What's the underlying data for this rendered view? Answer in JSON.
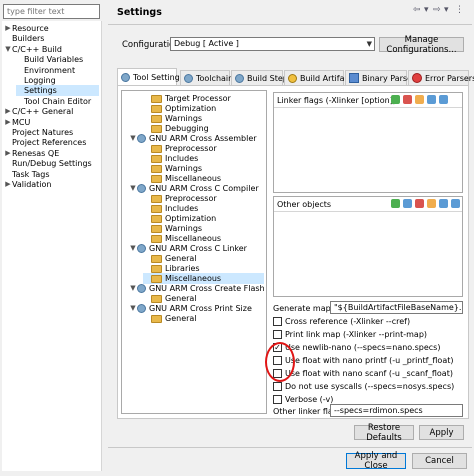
{
  "sidebar": {
    "filter_placeholder": "type filter text",
    "items": [
      {
        "label": "Resource",
        "twisty": "▶",
        "indent": 0
      },
      {
        "label": "Builders",
        "twisty": "",
        "indent": 0
      },
      {
        "label": "C/C++ Build",
        "twisty": "▼",
        "indent": 0
      },
      {
        "label": "Build Variables",
        "twisty": "",
        "indent": 1
      },
      {
        "label": "Environment",
        "twisty": "",
        "indent": 1
      },
      {
        "label": "Logging",
        "twisty": "",
        "indent": 1
      },
      {
        "label": "Settings",
        "twisty": "",
        "indent": 1,
        "selected": true
      },
      {
        "label": "Tool Chain Editor",
        "twisty": "",
        "indent": 1
      },
      {
        "label": "C/C++ General",
        "twisty": "▶",
        "indent": 0
      },
      {
        "label": "MCU",
        "twisty": "▶",
        "indent": 0
      },
      {
        "label": "Project Natures",
        "twisty": "",
        "indent": 0
      },
      {
        "label": "Project References",
        "twisty": "",
        "indent": 0
      },
      {
        "label": "Renesas QE",
        "twisty": "▶",
        "indent": 0
      },
      {
        "label": "Run/Debug Settings",
        "twisty": "",
        "indent": 0
      },
      {
        "label": "Task Tags",
        "twisty": "",
        "indent": 0
      },
      {
        "label": "Validation",
        "twisty": "▶",
        "indent": 0
      }
    ]
  },
  "header": {
    "title": "Settings"
  },
  "config": {
    "label": "Configuration:",
    "value": "Debug  [ Active ]",
    "manage_button": "Manage Configurations..."
  },
  "tabs": [
    {
      "label": "Tool Settings",
      "active": true
    },
    {
      "label": "Toolchain",
      "active": false
    },
    {
      "label": "Build Steps",
      "active": false
    },
    {
      "label": "Build Artifact",
      "active": false
    },
    {
      "label": "Binary Parsers",
      "active": false
    },
    {
      "label": "Error Parsers",
      "active": false
    }
  ],
  "tool_tree": [
    {
      "label": "Target Processor",
      "level": 1,
      "twisty": "",
      "kind": "folder"
    },
    {
      "label": "Optimization",
      "level": 1,
      "twisty": "",
      "kind": "folder"
    },
    {
      "label": "Warnings",
      "level": 1,
      "twisty": "",
      "kind": "folder"
    },
    {
      "label": "Debugging",
      "level": 1,
      "twisty": "",
      "kind": "folder"
    },
    {
      "label": "GNU ARM Cross Assembler",
      "level": 0,
      "twisty": "▼",
      "kind": "gear"
    },
    {
      "label": "Preprocessor",
      "level": 1,
      "twisty": "",
      "kind": "folder"
    },
    {
      "label": "Includes",
      "level": 1,
      "twisty": "",
      "kind": "folder"
    },
    {
      "label": "Warnings",
      "level": 1,
      "twisty": "",
      "kind": "folder"
    },
    {
      "label": "Miscellaneous",
      "level": 1,
      "twisty": "",
      "kind": "folder"
    },
    {
      "label": "GNU ARM Cross C Compiler",
      "level": 0,
      "twisty": "▼",
      "kind": "gear"
    },
    {
      "label": "Preprocessor",
      "level": 1,
      "twisty": "",
      "kind": "folder"
    },
    {
      "label": "Includes",
      "level": 1,
      "twisty": "",
      "kind": "folder"
    },
    {
      "label": "Optimization",
      "level": 1,
      "twisty": "",
      "kind": "folder"
    },
    {
      "label": "Warnings",
      "level": 1,
      "twisty": "",
      "kind": "folder"
    },
    {
      "label": "Miscellaneous",
      "level": 1,
      "twisty": "",
      "kind": "folder"
    },
    {
      "label": "GNU ARM Cross C Linker",
      "level": 0,
      "twisty": "▼",
      "kind": "gear"
    },
    {
      "label": "General",
      "level": 1,
      "twisty": "",
      "kind": "folder"
    },
    {
      "label": "Libraries",
      "level": 1,
      "twisty": "",
      "kind": "folder"
    },
    {
      "label": "Miscellaneous",
      "level": 1,
      "twisty": "",
      "kind": "folder",
      "selected": true
    },
    {
      "label": "GNU ARM Cross Create Flash Image",
      "level": 0,
      "twisty": "▼",
      "kind": "gear"
    },
    {
      "label": "General",
      "level": 1,
      "twisty": "",
      "kind": "folder"
    },
    {
      "label": "GNU ARM Cross Print Size",
      "level": 0,
      "twisty": "▼",
      "kind": "gear"
    },
    {
      "label": "General",
      "level": 1,
      "twisty": "",
      "kind": "folder"
    }
  ],
  "options": {
    "linker_flags_label": "Linker flags (-Xlinker [option])",
    "other_objects_label": "Other objects",
    "generate_map_label": "Generate map",
    "generate_map_value": "\"${BuildArtifactFileBaseName}.map\"",
    "checkboxes": [
      {
        "label": "Cross reference (-Xlinker --cref)",
        "checked": false
      },
      {
        "label": "Print link map (-Xlinker --print-map)",
        "checked": false
      },
      {
        "label": "Use newlib-nano (--specs=nano.specs)",
        "checked": true
      },
      {
        "label": "Use float with nano printf (-u _printf_float)",
        "checked": false
      },
      {
        "label": "Use float with nano scanf (-u _scanf_float)",
        "checked": false
      },
      {
        "label": "Do not use syscalls (--specs=nosys.specs)",
        "checked": false
      },
      {
        "label": "Verbose (-v)",
        "checked": false
      }
    ],
    "other_linker_flags_label": "Other linker flags",
    "other_linker_flags_value": "--specs=rdimon.specs"
  },
  "buttons": {
    "restore_defaults": "Restore Defaults",
    "apply": "Apply",
    "apply_and_close": "Apply and Close",
    "cancel": "Cancel"
  },
  "colors": {
    "selection": "#cce8ff",
    "annotation_circle": "#e01616",
    "primary_button_border": "#0078d7"
  }
}
